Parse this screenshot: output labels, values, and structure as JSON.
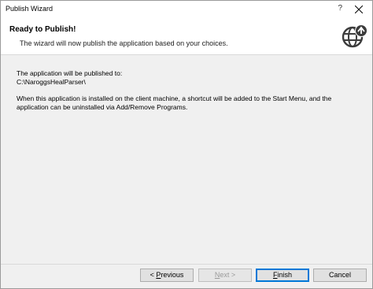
{
  "window": {
    "title": "Publish Wizard",
    "help": "?"
  },
  "header": {
    "title": "Ready to Publish!",
    "subtitle": "The wizard will now publish the application based on your choices.",
    "icon": "globe-upload-icon"
  },
  "content": {
    "line1": "The application will be published to:",
    "path": "C:\\NaroggsHealParser\\",
    "info": "When this application is installed on the client machine, a shortcut will be added to the Start Menu, and the application can be uninstalled via Add/Remove Programs."
  },
  "buttons": {
    "previous": {
      "prefix": "< ",
      "accel": "P",
      "rest": "revious"
    },
    "next": {
      "accel": "N",
      "rest": "ext >"
    },
    "finish": {
      "accel": "F",
      "rest": "inish"
    },
    "cancel": "Cancel"
  }
}
